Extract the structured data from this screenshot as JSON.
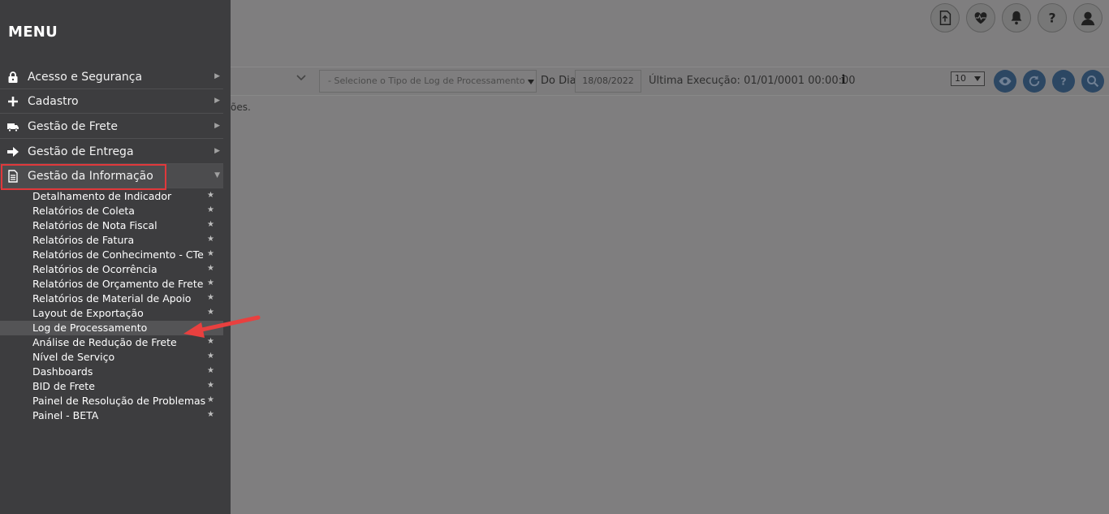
{
  "menu": {
    "title": "MENU",
    "items": [
      {
        "label": "Acesso e Segurança",
        "icon": "lock-icon"
      },
      {
        "label": "Cadastro",
        "icon": "plus-icon"
      },
      {
        "label": "Gestão de Frete",
        "icon": "truck-icon"
      },
      {
        "label": "Gestão de Entrega",
        "icon": "arrow-right-icon"
      },
      {
        "label": "Gestão da Informação",
        "icon": "document-icon"
      }
    ],
    "submenu": [
      {
        "label": "Detalhamento de Indicador"
      },
      {
        "label": "Relatórios de Coleta"
      },
      {
        "label": "Relatórios de Nota Fiscal"
      },
      {
        "label": "Relatórios de Fatura"
      },
      {
        "label": "Relatórios de Conhecimento - CTe"
      },
      {
        "label": "Relatórios de Ocorrência"
      },
      {
        "label": "Relatórios de Orçamento de Frete"
      },
      {
        "label": "Relatórios de Material de Apoio"
      },
      {
        "label": "Layout de Exportação"
      },
      {
        "label": "Log de Processamento"
      },
      {
        "label": "Análise de Redução de Frete"
      },
      {
        "label": "Nível de Serviço"
      },
      {
        "label": "Dashboards"
      },
      {
        "label": "BID de Frete"
      },
      {
        "label": "Painel de Resolução de Problemas"
      },
      {
        "label": "Painel - BETA"
      }
    ],
    "star_glyph": "★"
  },
  "toolbar": {
    "log_type_placeholder": "- Selecione o Tipo de Log de Processamento -",
    "day_label": "Do Dia",
    "date_value": "18/08/2022",
    "last_execution": "Última Execução: 01/01/0001 00:00:00",
    "info_glyph": "i",
    "page_size": "10"
  },
  "content": {
    "partial_text": "ões."
  },
  "header_icons": [
    "upload-icon",
    "heart-pulse-icon",
    "bell-icon",
    "help-icon",
    "user-icon"
  ],
  "toolbar_buttons": [
    "eye-icon",
    "refresh-icon",
    "help-icon",
    "search-icon"
  ],
  "colors": {
    "sidebar_bg": "#3d3d3f",
    "overlay_bg": "#7f7e7f",
    "highlight": "#e0383b",
    "button_bg": "#2c4763"
  }
}
